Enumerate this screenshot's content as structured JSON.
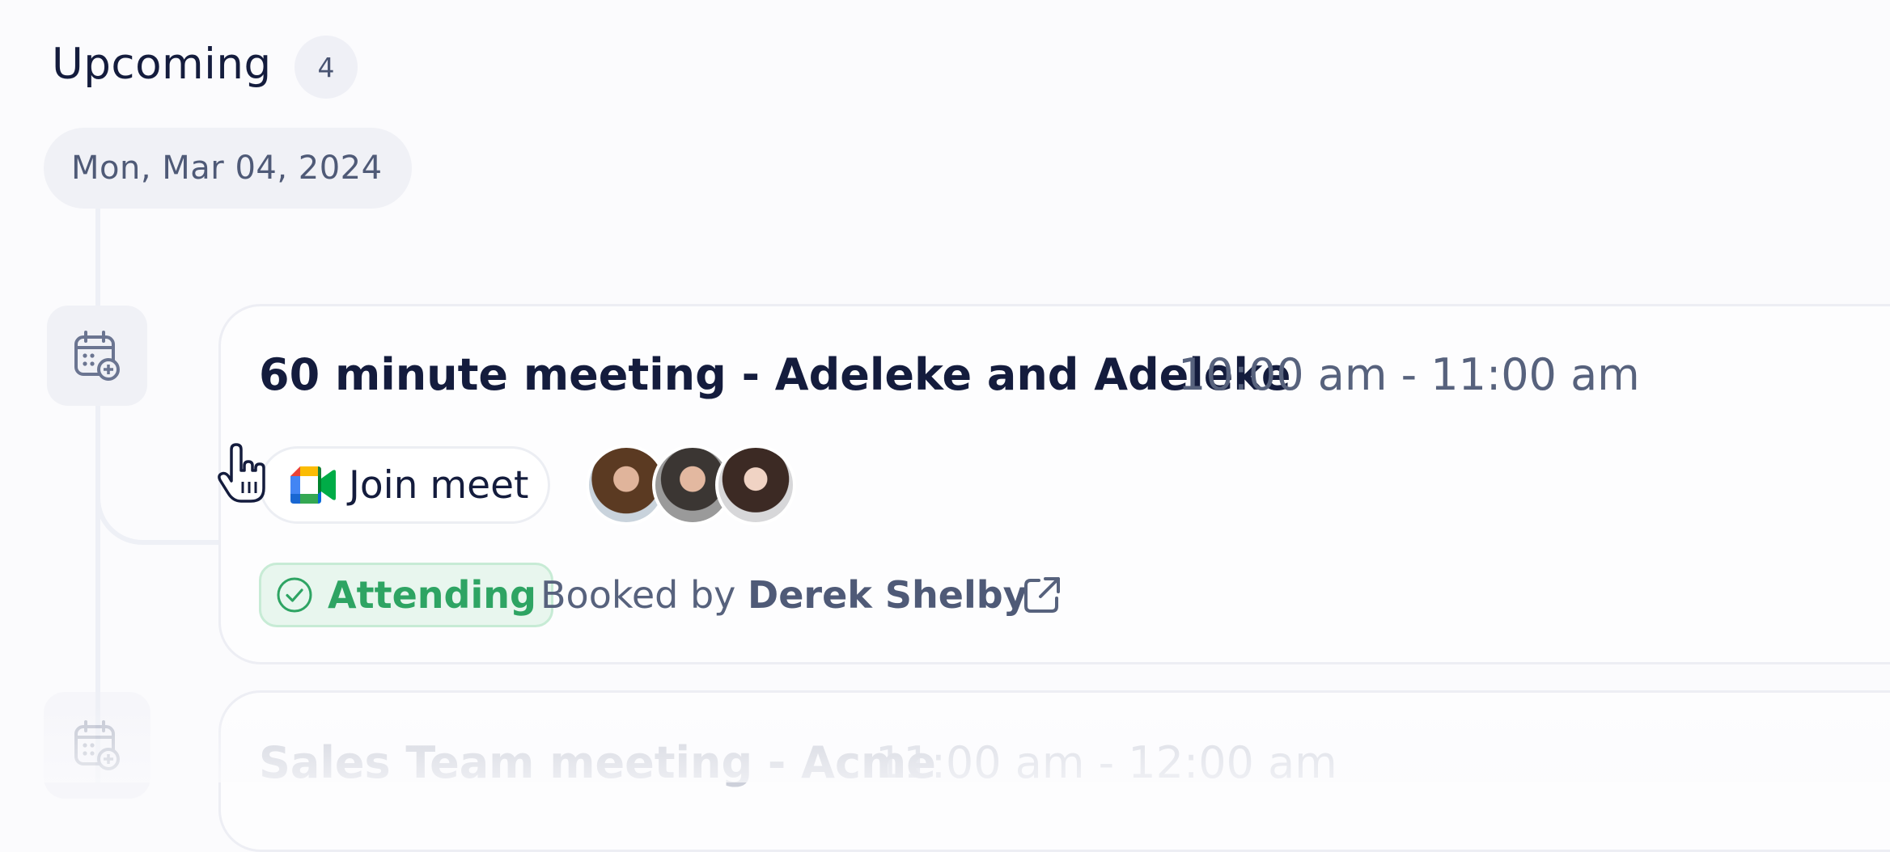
{
  "section": {
    "title": "Upcoming",
    "count": "4"
  },
  "date": "Mon, Mar 04, 2024",
  "events": [
    {
      "title": "60 minute meeting - Adeleke and Adeleke",
      "time": "10:00 am - 11:00 am",
      "join_label": "Join meet",
      "status": "Attending",
      "booked_prefix": "Booked by",
      "booked_name": "Derek Shelby",
      "icon": "calendar-plus-icon"
    },
    {
      "title": "Sales Team meeting - Acme",
      "time": "11:00 am - 12:00 am",
      "icon": "calendar-plus-icon"
    }
  ],
  "colors": {
    "status_green": "#2ea463",
    "text_primary": "#141c3d",
    "text_secondary": "#57627d"
  }
}
